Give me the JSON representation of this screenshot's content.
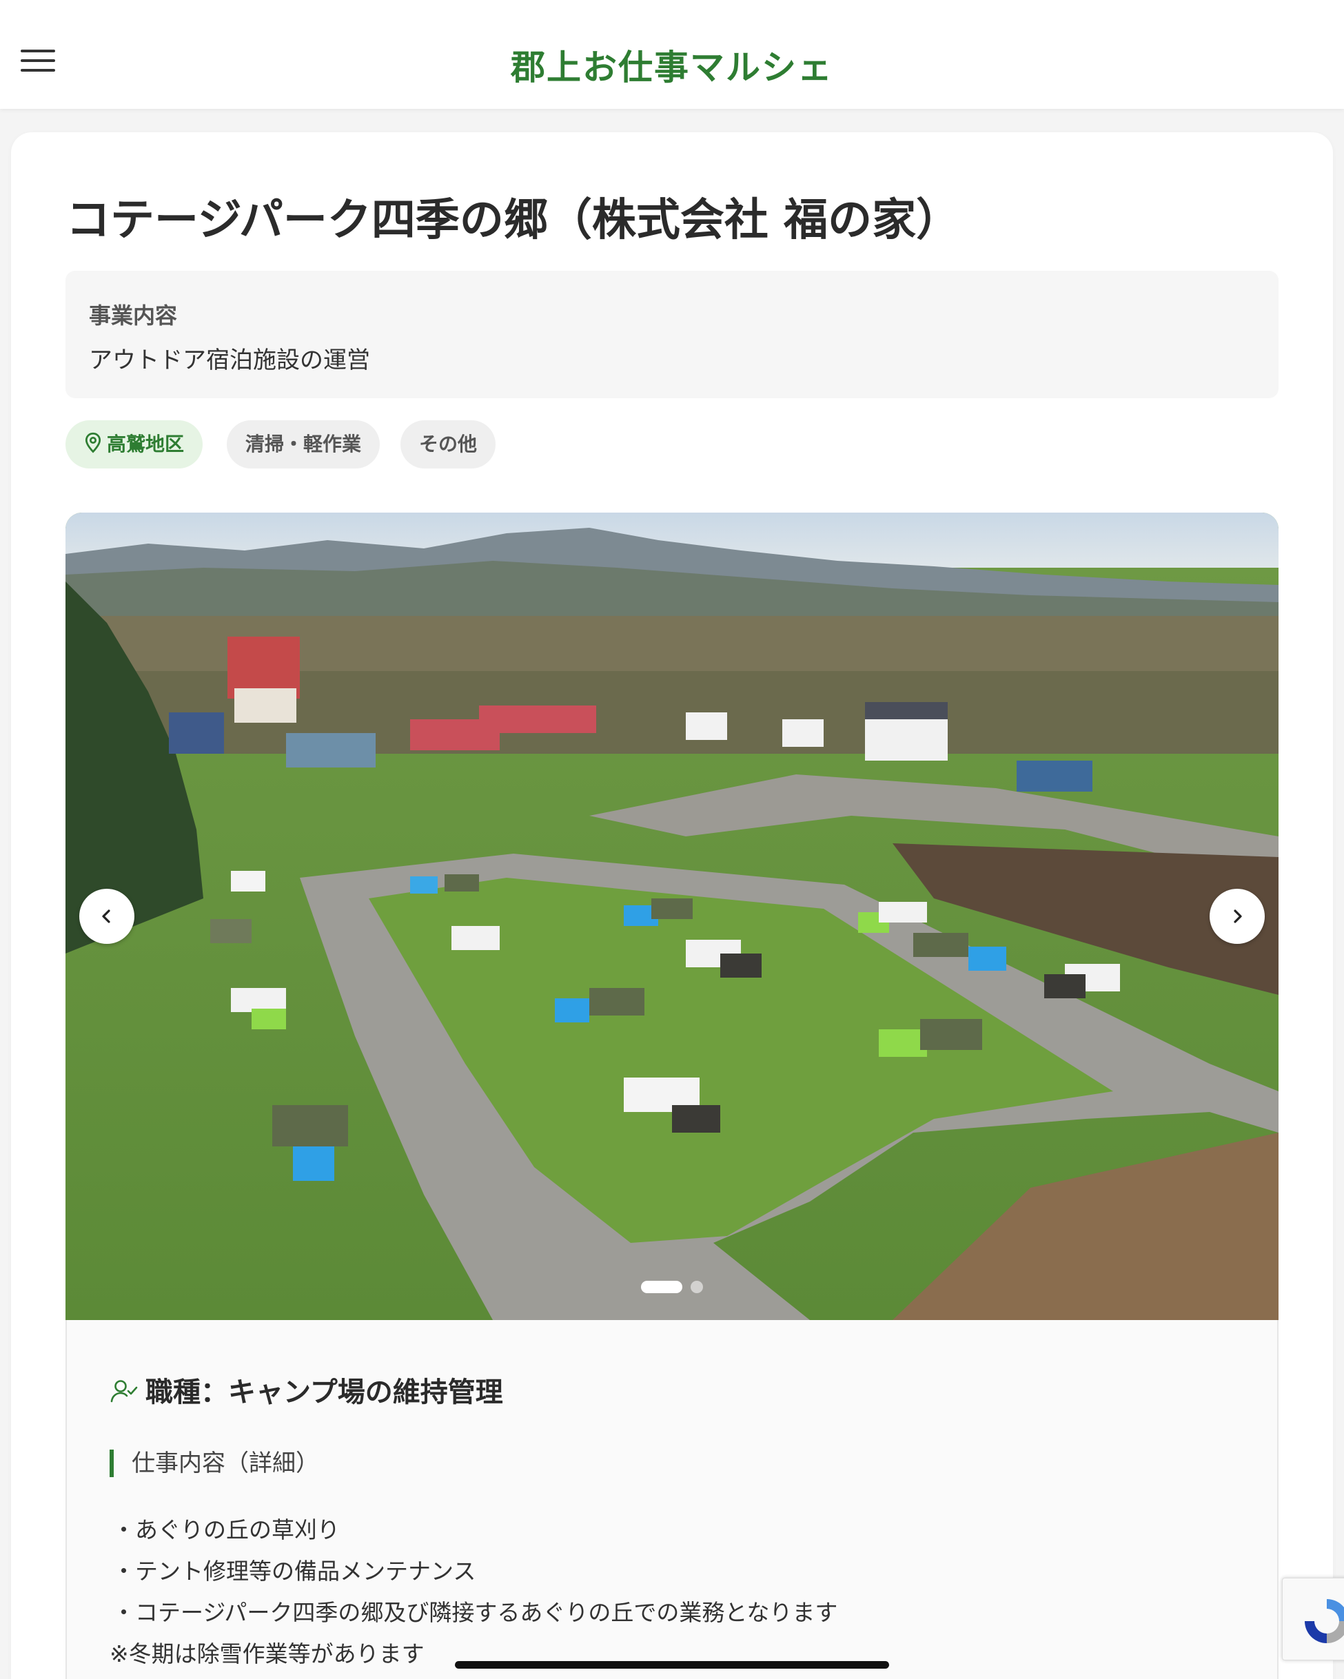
{
  "header": {
    "menu_icon": "hamburger-menu-icon",
    "title": "郡上お仕事マルシェ"
  },
  "company": {
    "name": "コテージパーク四季の郷（株式会社 福の家）",
    "business_label": "事業内容",
    "business_value": "アウトドア宿泊施設の運営"
  },
  "tags": [
    {
      "label": "高鷲地区",
      "icon": "map-pin-icon",
      "accent": "#2e7d32"
    },
    {
      "label": "清掃・軽作業"
    },
    {
      "label": "その他"
    }
  ],
  "carousel": {
    "prev_icon": "chevron-left-icon",
    "next_icon": "chevron-right-icon",
    "slide_count": 2,
    "active_index": 0
  },
  "job": {
    "title": "職種：キャンプ場の維持管理",
    "icon": "person-check-icon",
    "section_label": "仕事内容（詳細）",
    "duties": [
      "・あぐりの丘の草刈り",
      "・テント修理等の備品メンテナンス",
      "・コテージパーク四季の郷及び隣接するあぐりの丘での業務となります",
      "※冬期は除雪作業等があります"
    ]
  },
  "colors": {
    "brand_green": "#2e7d32",
    "tag_bg": "#efefef",
    "location_tag_bg": "#e6f4e4"
  }
}
